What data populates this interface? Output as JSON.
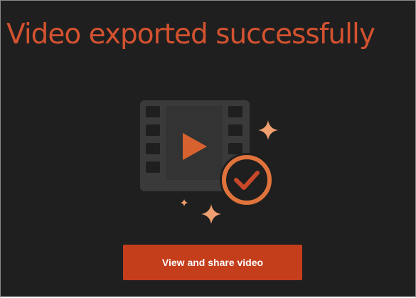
{
  "dialog": {
    "title": "Video exported successfully",
    "primary_button_label": "View and share video"
  },
  "illustration": {
    "icons": [
      "film-strip-icon",
      "play-icon",
      "checkmark-badge-icon",
      "sparkle-icon"
    ]
  },
  "colors": {
    "background": "#1f1f1f",
    "accent": "#d35230",
    "button": "#c43e1c",
    "illustration_orange": "#e0733c",
    "film_gray": "#3a3a3a"
  }
}
